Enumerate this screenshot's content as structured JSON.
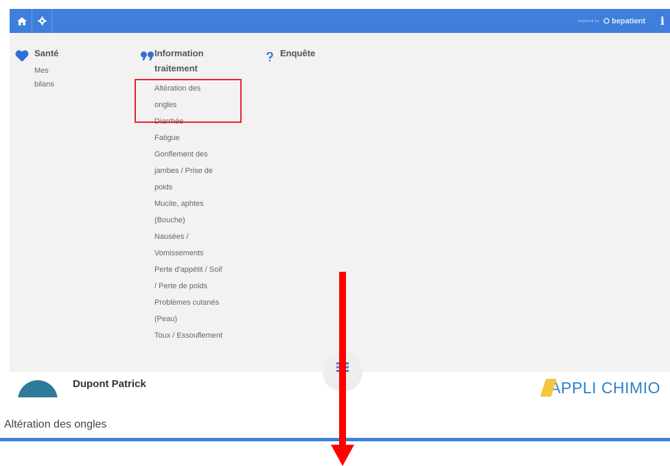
{
  "topbar": {
    "home_icon": "home-icon",
    "settings_icon": "gear-icon",
    "brand_small": "powered by",
    "brand_name": "bepatient",
    "info_icon": "info-icon",
    "colors": {
      "bar": "#3f7fdb"
    }
  },
  "menu": {
    "sante": {
      "icon": "heart-icon",
      "title": "Santé",
      "items": [
        "Mes bilans"
      ]
    },
    "information": {
      "icon": "quote-icon",
      "title_line1": "Information",
      "title_line2": "traitement",
      "items": [
        [
          "Altération des",
          "ongles"
        ],
        [
          "Diarrhée"
        ],
        [
          "Fatigue"
        ],
        [
          "Gonflement des",
          "jambes / Prise de",
          "poids"
        ],
        [
          "Mucite, aphtes",
          "(Bouche)"
        ],
        [
          "Nausées /",
          "Vomissements"
        ],
        [
          "Perte d'appétit / Soif",
          "/ Perte de poids"
        ],
        [
          "Problèmes cutanés",
          "(Peau)"
        ],
        [
          "Toux / Essouflement"
        ]
      ]
    },
    "enquete": {
      "icon": "question-icon",
      "title": "Enquête"
    }
  },
  "fab_icon": "menu-icon",
  "user": {
    "name": "Dupont Patrick",
    "logo_text": "APPLI CHIMIO"
  },
  "page": {
    "title": "Altération des ongles"
  },
  "annotation": {
    "highlight_color": "#e8202a",
    "arrow_color": "#ff0000"
  }
}
